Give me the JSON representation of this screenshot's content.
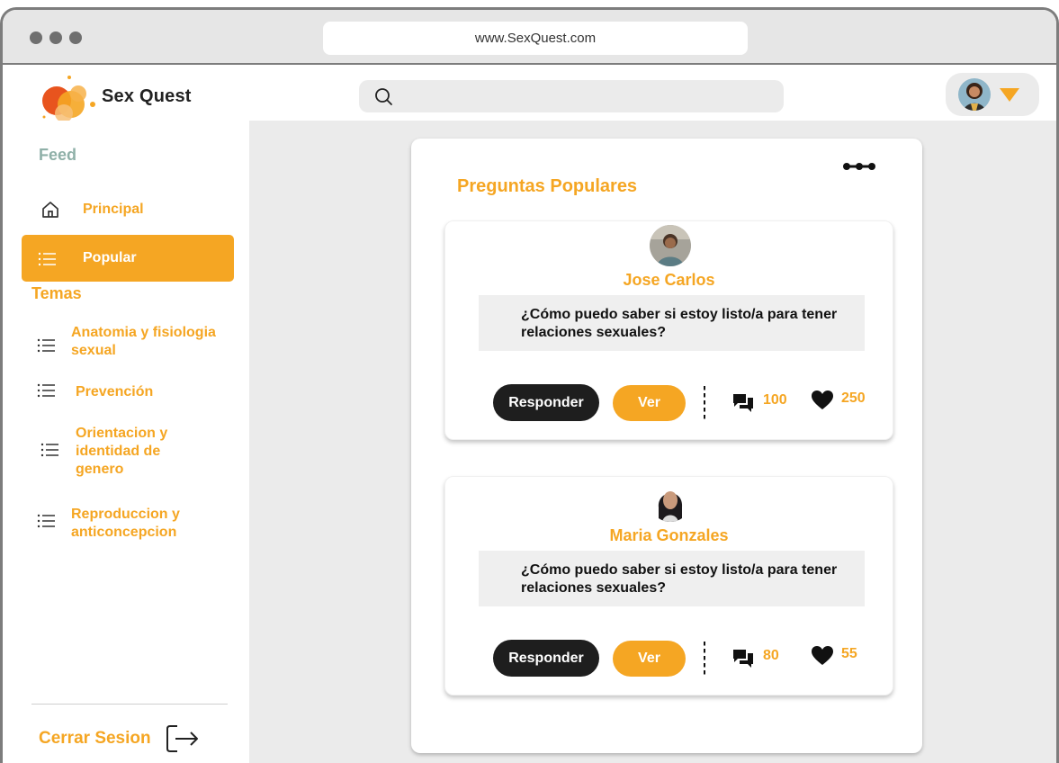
{
  "browser": {
    "url": "www.SexQuest.com"
  },
  "brand": {
    "name": "Sex Quest",
    "accent_color": "#f5a623"
  },
  "search": {
    "placeholder": ""
  },
  "sidebar": {
    "feed_heading": "Feed",
    "feed_items": [
      {
        "label": "Principal",
        "icon": "home-icon",
        "active": false
      },
      {
        "label": "Popular",
        "icon": "list-icon",
        "active": true
      }
    ],
    "topics_heading": "Temas",
    "topics": [
      {
        "label": "Anatomia y fisiologia sexual",
        "icon": "list-icon"
      },
      {
        "label": "Prevención",
        "icon": "list-icon"
      },
      {
        "label": "Orientacion y identidad de genero",
        "icon": "list-icon"
      },
      {
        "label": "Reproduccion y anticoncepcion",
        "icon": "list-icon"
      }
    ],
    "logout_label": "Cerrar Sesion"
  },
  "main": {
    "panel_title": "Preguntas Populares",
    "questions": [
      {
        "author": "Jose Carlos",
        "question": "¿Cómo puedo saber si estoy listo/a para tener relaciones sexuales?",
        "reply_label": "Responder",
        "view_label": "Ver",
        "comments": "100",
        "likes": "250"
      },
      {
        "author": "Maria Gonzales",
        "question": "¿Cómo puedo saber si estoy listo/a para tener relaciones sexuales?",
        "reply_label": "Responder",
        "view_label": "Ver",
        "comments": "80",
        "likes": "55"
      }
    ]
  }
}
